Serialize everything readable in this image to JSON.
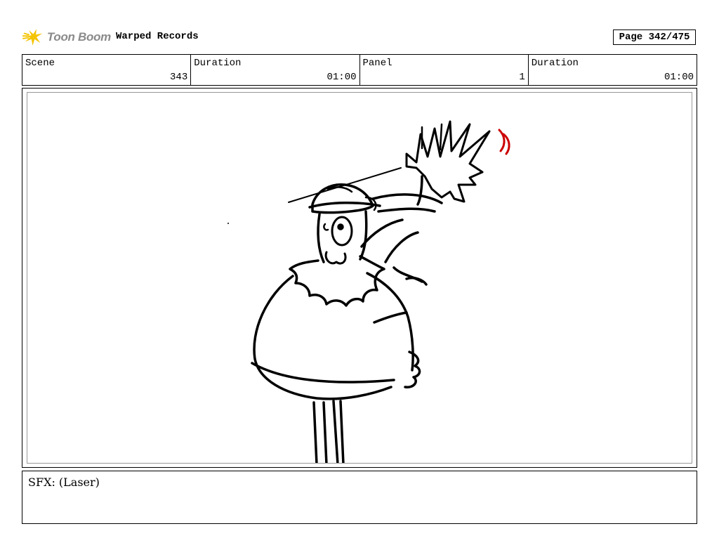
{
  "header": {
    "logo_text": "Toon Boom",
    "project_title": "Warped Records",
    "page_label": "Page 342/475"
  },
  "info": {
    "scene_label": "Scene",
    "scene_value": "343",
    "duration_label": "Duration",
    "duration_value": "01:00",
    "panel_label": "Panel",
    "panel_value": "1",
    "panel_duration_label": "Duration",
    "panel_duration_value": "01:00"
  },
  "caption": {
    "text": "SFX: (Laser)"
  },
  "colors": {
    "logo_star": "#f5c400",
    "logo_text": "#8a8a8a",
    "sfx_marks": "#cc0000"
  }
}
